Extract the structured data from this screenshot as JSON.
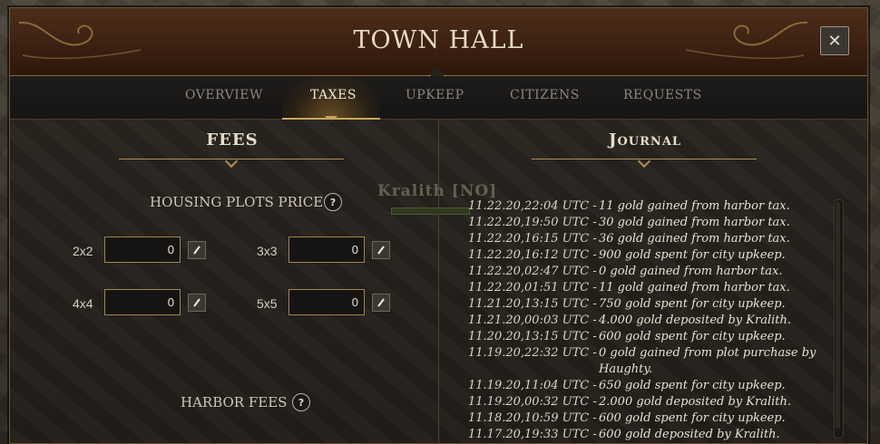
{
  "window": {
    "title": "TOWN HALL",
    "close_label": "✕"
  },
  "tabs": [
    {
      "label": "OVERVIEW",
      "active": false
    },
    {
      "label": "TAXES",
      "active": true
    },
    {
      "label": "UPKEEP",
      "active": false
    },
    {
      "label": "CITIZENS",
      "active": false
    },
    {
      "label": "REQUESTS",
      "active": false
    }
  ],
  "fees": {
    "heading": "FEES",
    "housing_label": "HOUSING PLOTS PRICE",
    "help_label": "?",
    "plots": [
      {
        "size": "2x2",
        "value": "0"
      },
      {
        "size": "3x3",
        "value": "0"
      },
      {
        "size": "4x4",
        "value": "0"
      },
      {
        "size": "5x5",
        "value": "0"
      }
    ],
    "harbor_label": "HARBOR FEES"
  },
  "world": {
    "nameplate": "Kralith [NO]"
  },
  "journal": {
    "heading": "Journal",
    "entries": [
      {
        "ts": "11.22.20,22:04 UTC -",
        "msg": "11 gold gained from harbor tax."
      },
      {
        "ts": "11.22.20,19:50 UTC -",
        "msg": "30 gold gained from harbor tax."
      },
      {
        "ts": "11.22.20,16:15 UTC -",
        "msg": "36 gold gained from harbor tax."
      },
      {
        "ts": "11.22.20,16:12 UTC -",
        "msg": "900 gold spent for city upkeep."
      },
      {
        "ts": "11.22.20,02:47 UTC -",
        "msg": "0 gold gained from harbor tax."
      },
      {
        "ts": "11.22.20,01:51 UTC -",
        "msg": "11 gold gained from harbor tax."
      },
      {
        "ts": "11.21.20,13:15 UTC -",
        "msg": "750 gold spent for city upkeep."
      },
      {
        "ts": "11.21.20,00:03 UTC -",
        "msg": "4.000 gold deposited by Kralith."
      },
      {
        "ts": "11.20.20,13:15 UTC -",
        "msg": "600 gold spent for city upkeep."
      },
      {
        "ts": "11.19.20,22:32 UTC -",
        "msg": "0 gold gained from plot purchase by Haughty."
      },
      {
        "ts": "11.19.20,11:04 UTC -",
        "msg": "650 gold spent for city upkeep."
      },
      {
        "ts": "11.19.20,00:32 UTC -",
        "msg": "2.000 gold deposited by Kralith."
      },
      {
        "ts": "11.18.20,10:59 UTC -",
        "msg": "600 gold spent for city upkeep."
      },
      {
        "ts": "11.17.20,19:33 UTC -",
        "msg": "600 gold deposited by Kralith."
      }
    ]
  }
}
